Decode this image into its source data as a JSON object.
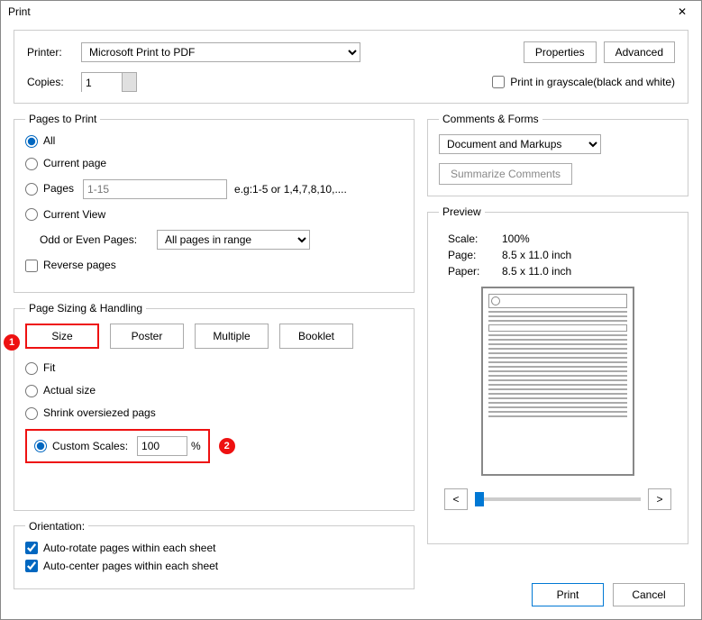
{
  "title": "Print",
  "printer_row": {
    "label": "Printer:",
    "value": "Microsoft Print to PDF",
    "properties": "Properties",
    "advanced": "Advanced"
  },
  "copies_row": {
    "label": "Copies:",
    "value": "1",
    "grayscale": "Print in grayscale(black and white)"
  },
  "pages_to_print": {
    "legend": "Pages to Print",
    "all": "All",
    "current_page": "Current page",
    "pages": "Pages",
    "pages_placeholder": "1-15",
    "pages_hint": "e.g:1-5 or 1,4,7,8,10,....",
    "current_view": "Current View",
    "odd_even_label": "Odd or Even Pages:",
    "odd_even_value": "All pages in range",
    "reverse": "Reverse pages"
  },
  "sizing": {
    "legend": "Page Sizing & Handling",
    "size": "Size",
    "poster": "Poster",
    "multiple": "Multiple",
    "booklet": "Booklet",
    "fit": "Fit",
    "actual": "Actual size",
    "shrink": "Shrink oversiezed pags",
    "custom": "Custom Scales:",
    "custom_value": "100",
    "percent": "%"
  },
  "orientation": {
    "legend": "Orientation:",
    "auto_rotate": "Auto-rotate pages within each sheet",
    "auto_center": "Auto-center pages within each sheet"
  },
  "comments": {
    "legend": "Comments & Forms",
    "value": "Document and Markups",
    "summarize": "Summarize Comments"
  },
  "preview": {
    "legend": "Preview",
    "scale_label": "Scale:",
    "scale_value": "100%",
    "page_label": "Page:",
    "page_value": "8.5 x 11.0 inch",
    "paper_label": "Paper:",
    "paper_value": "8.5 x 11.0 inch",
    "prev": "<",
    "next": ">"
  },
  "annotations": {
    "b1": "1",
    "b2": "2"
  },
  "buttons": {
    "print": "Print",
    "cancel": "Cancel"
  }
}
